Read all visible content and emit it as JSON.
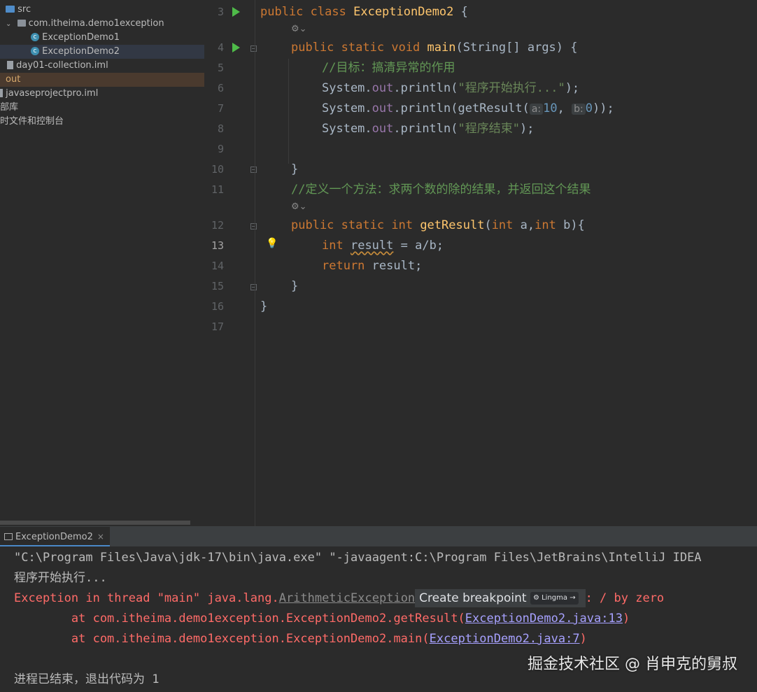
{
  "project_tree": {
    "items": [
      {
        "label": "src",
        "type": "folder"
      },
      {
        "label": "com.itheima.demo1exception",
        "type": "package"
      },
      {
        "label": "ExceptionDemo1",
        "type": "class"
      },
      {
        "label": "ExceptionDemo2",
        "type": "class"
      },
      {
        "label": "day01-collection.iml",
        "type": "file"
      },
      {
        "label": "out",
        "type": "folder"
      },
      {
        "label": "javaseprojectpro.iml",
        "type": "file"
      },
      {
        "label": "部库",
        "type": "node"
      },
      {
        "label": "时文件和控制台",
        "type": "node"
      }
    ]
  },
  "editor": {
    "line_numbers": [
      "3",
      "4",
      "5",
      "6",
      "7",
      "8",
      "9",
      "10",
      "11",
      "12",
      "13",
      "14",
      "15",
      "16",
      "17"
    ],
    "current_line": "13",
    "lines": {
      "l3": {
        "kw1": "public",
        "kw2": "class",
        "name": "ExceptionDemo2",
        "brace": " {"
      },
      "l4": {
        "kw1": "public",
        "kw2": "static",
        "kw3": "void",
        "fn": "main",
        "params": "(String[] args) {"
      },
      "l5": {
        "comment": "//目标：搞清异常的作用"
      },
      "l6": {
        "sys": "System.",
        "out": "out",
        "call": ".println(",
        "str": "\"程序开始执行...\"",
        "end": ");"
      },
      "l7": {
        "sys": "System.",
        "out": "out",
        "call": ".println(getResult(",
        "hint_a": "a:",
        "val_a": "10",
        "comma": ", ",
        "hint_b": "b:",
        "val_b": "0",
        "end": "));"
      },
      "l8": {
        "sys": "System.",
        "out": "out",
        "call": ".println(",
        "str": "\"程序结束\"",
        "end": ");"
      },
      "l10": {
        "text": "}"
      },
      "l11": {
        "comment": "//定义一个方法：求两个数的除的结果，并返回这个结果"
      },
      "l12": {
        "kw1": "public",
        "kw2": "static",
        "kw3": "int",
        "fn": "getResult",
        "p1": "(",
        "kw4": "int",
        "p2": " a,",
        "kw5": "int",
        "p3": " b){"
      },
      "l13": {
        "kw": "int",
        "var": "result",
        "rest": " = a/b;"
      },
      "l14": {
        "kw": "return",
        "rest": " result;"
      },
      "l15": {
        "text": "}"
      },
      "l16": {
        "text": "}"
      }
    },
    "lens_icon": "ai-lens-icon"
  },
  "run_panel": {
    "tab_label": "ExceptionDemo2",
    "lines": {
      "cmd": "\"C:\\Program Files\\Java\\jdk-17\\bin\\java.exe\" \"-javaagent:C:\\Program Files\\JetBrains\\IntelliJ IDEA",
      "start": "程序开始执行...",
      "exc_prefix": "Exception in thread \"main\" java.lang.",
      "exc_class": "ArithmeticException",
      "create_bp": "Create breakpoint",
      "lingma": "Lingma →",
      "exc_suffix": ": / by zero",
      "at1_prefix": "        at com.itheima.demo1exception.ExceptionDemo2.getResult(",
      "at1_link": "ExceptionDemo2.java:13",
      "at1_end": ")",
      "at2_prefix": "        at com.itheima.demo1exception.ExceptionDemo2.main(",
      "at2_link": "ExceptionDemo2.java:7",
      "at2_end": ")",
      "exit": "进程已结束，退出代码为 1"
    },
    "watermark": "掘金技术社区 @ 肖申克的舅叔"
  },
  "colors": {
    "keyword": "#cc7832",
    "function": "#ffc66d",
    "string": "#6a8759",
    "comment": "#629755",
    "error": "#ff6b68",
    "link": "#a7a1ff"
  }
}
